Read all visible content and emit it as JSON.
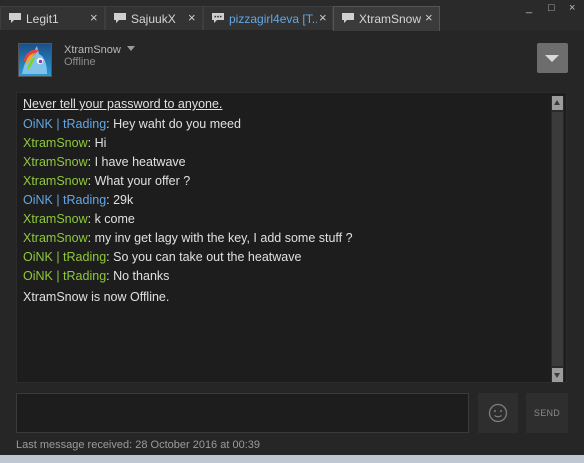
{
  "window": {
    "controls": [
      "_",
      "□",
      "×"
    ]
  },
  "tabs": [
    {
      "label": "Legit1",
      "unread": false
    },
    {
      "label": "SajuukX",
      "unread": false
    },
    {
      "label": "pizzagirl4eva [T...",
      "unread": true
    },
    {
      "label": "XtramSnow",
      "unread": false,
      "active": true
    }
  ],
  "tab_close": "×",
  "header": {
    "username": "XtramSnow",
    "status": "Offline"
  },
  "chat": {
    "warning": "Never tell your password to anyone.",
    "messages": [
      {
        "sender": "OiNK | tRading",
        "text": "Hey waht do you meed"
      },
      {
        "sender": "XtramSnow",
        "text": "Hi"
      },
      {
        "sender": "XtramSnow",
        "text": "I have heatwave"
      },
      {
        "sender": "XtramSnow",
        "text": "What your offer ?"
      },
      {
        "sender": "OiNK | tRading",
        "text": "29k"
      },
      {
        "sender": "XtramSnow",
        "text": "k come"
      },
      {
        "sender": "XtramSnow",
        "text": "my inv get lagy with the key, I add some stuff ?"
      },
      {
        "sender": "OiNK | tRading",
        "text": "So you can take out the heatwave"
      },
      {
        "sender": "OiNK | tRading",
        "text": "No thanks"
      }
    ],
    "system_message": "XtramSnow is now Offline.",
    "separator": ": "
  },
  "composer": {
    "placeholder": "",
    "send_label": "SEND"
  },
  "footer": {
    "last_message": "Last message received: 28 October 2016 at 00:39"
  },
  "colors": {
    "sender_other_blue": "#62a7e3",
    "sender_green": "#8fc93a",
    "background": "#262626",
    "chat_background": "#1d1d1d"
  },
  "icons": [
    "chat-bubble-icon",
    "close-icon",
    "dropdown-caret-icon",
    "menu-dropdown-icon",
    "emoticon-icon",
    "scroll-up-icon",
    "scroll-down-icon"
  ]
}
